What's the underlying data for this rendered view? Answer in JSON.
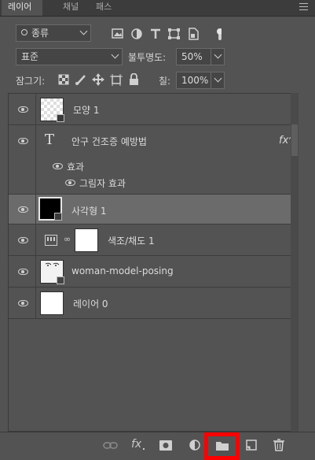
{
  "tabs": [
    {
      "label": "레이어",
      "active": true
    },
    {
      "label": "채널",
      "active": false
    },
    {
      "label": "패스",
      "active": false
    }
  ],
  "filter": {
    "kind_label": "종류"
  },
  "blend": {
    "mode": "표준",
    "opacity_label": "불투명도:",
    "opacity_value": "50%"
  },
  "lock": {
    "label": "잠그기:",
    "fill_label": "칠:",
    "fill_value": "100%"
  },
  "layers": [
    {
      "name": "모양 1",
      "type": "shape"
    },
    {
      "name": "안구 건조증 예방법",
      "type": "text",
      "fx": "fx"
    },
    {
      "name": "효과",
      "type": "effects-header"
    },
    {
      "name": "그림자 효과",
      "type": "effect"
    },
    {
      "name": "사각형 1",
      "type": "shape",
      "selected": true
    },
    {
      "name": "색조/채도 1",
      "type": "adjustment"
    },
    {
      "name": "woman-model-posing",
      "type": "smart-object"
    },
    {
      "name": "레이어 0",
      "type": "pixel"
    }
  ],
  "bottom_icons": [
    "link-icon",
    "fx-icon",
    "mask-icon",
    "adjustment-icon",
    "new-group-icon",
    "new-layer-icon",
    "trash-icon"
  ],
  "colors": {
    "panel_bg": "#535353",
    "selected_row": "#6b6b6b",
    "highlight_box": "#ff0000"
  }
}
